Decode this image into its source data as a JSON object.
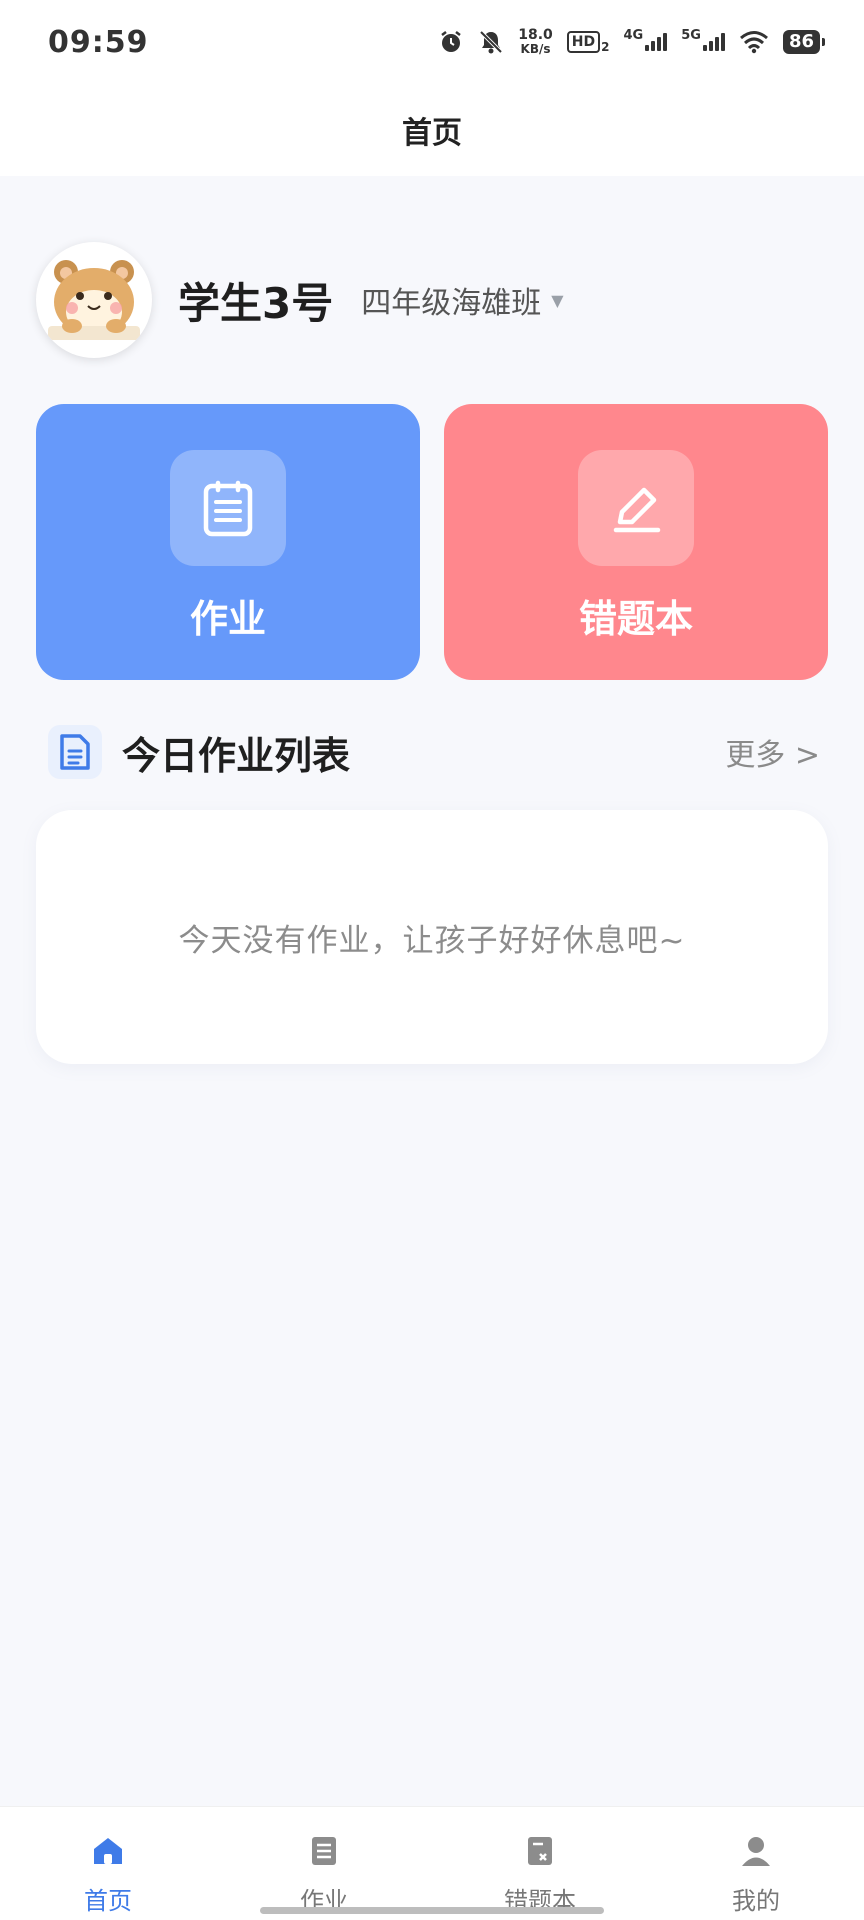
{
  "status_bar": {
    "time": "09:59",
    "net_speed_value": "18.0",
    "net_speed_unit": "KB/s",
    "hd_label": "HD",
    "hd_sub": "2",
    "network_4g": "4G",
    "network_5g": "5G",
    "battery": "86"
  },
  "header": {
    "title": "首页"
  },
  "profile": {
    "name": "学生3号",
    "class_name": "四年级海雄班",
    "dropdown_icon": "triangle-down-icon"
  },
  "cards": {
    "homework": {
      "label": "作业",
      "color": "#6699fa",
      "icon": "clipboard-icon"
    },
    "wrong_book": {
      "label": "错题本",
      "color": "#ff878d",
      "icon": "pencil-icon"
    }
  },
  "section": {
    "title": "今日作业列表",
    "more_label": "更多 >",
    "icon": "document-icon"
  },
  "homework_list": {
    "empty_message": "今天没有作业，让孩子好好休息吧~"
  },
  "bottom_nav": {
    "items": [
      {
        "label": "首页",
        "icon": "home-icon",
        "active": true
      },
      {
        "label": "作业",
        "icon": "homework-icon",
        "active": false
      },
      {
        "label": "错题本",
        "icon": "wrong-book-icon",
        "active": false
      },
      {
        "label": "我的",
        "icon": "user-icon",
        "active": false
      }
    ],
    "active_color": "#3f7be8"
  }
}
